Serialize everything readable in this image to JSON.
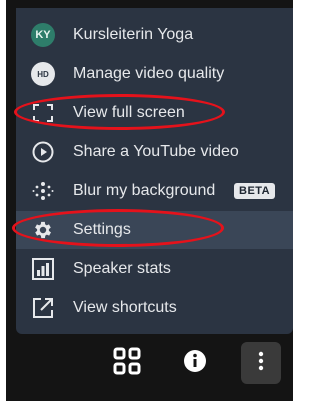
{
  "menu": {
    "items": [
      {
        "label": "Kursleiterin Yoga",
        "icon": "avatar",
        "avatar_initials": "KY"
      },
      {
        "label": "Manage video quality",
        "icon": "hd-icon",
        "badge_text": "HD"
      },
      {
        "label": "View full screen",
        "icon": "fullscreen-icon"
      },
      {
        "label": "Share a YouTube video",
        "icon": "play-icon"
      },
      {
        "label": "Blur my background",
        "icon": "blur-icon",
        "tag": "BETA"
      },
      {
        "label": "Settings",
        "icon": "gear-icon"
      },
      {
        "label": "Speaker stats",
        "icon": "bar-chart-icon"
      },
      {
        "label": "View shortcuts",
        "icon": "external-link-icon"
      }
    ]
  },
  "toolbar": {
    "buttons": [
      "grid-icon",
      "info-icon",
      "more-vertical-icon"
    ]
  },
  "colors": {
    "menu_bg": "#2b3442",
    "highlight_oval": "#e5121b",
    "avatar_bg": "#2e7d6a"
  }
}
